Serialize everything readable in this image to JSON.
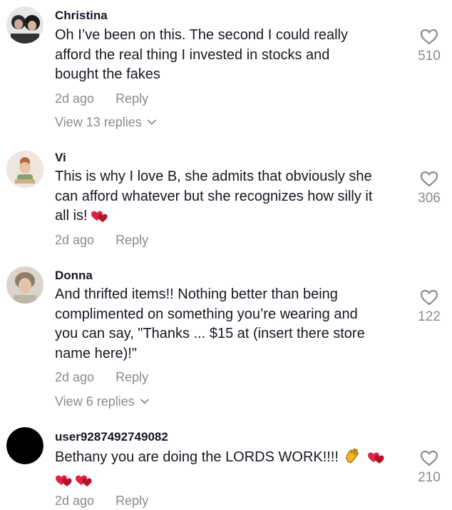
{
  "comments": [
    {
      "username": "Christina",
      "lines": [
        "Oh I’ve been on this. The second I could really",
        "afford the real thing I invested in stocks and",
        "bought the fakes"
      ],
      "time": "2d ago",
      "reply_label": "Reply",
      "view_replies": "View 13 replies",
      "likes": "510"
    },
    {
      "username": "Vi",
      "lines": [
        "This is why I love B, she admits that obviously she",
        "can afford whatever but she recognizes how silly it",
        "all is!"
      ],
      "time": "2d ago",
      "reply_label": "Reply",
      "likes": "306",
      "emoji": [
        "two-hearts-icon"
      ]
    },
    {
      "username": "Donna",
      "lines": [
        "And thrifted items!! Nothing better than being",
        "complimented on something you’re wearing and",
        "you can say, \"Thanks ... $15 at (insert there store",
        "name here)!\""
      ],
      "time": "2d ago",
      "reply_label": "Reply",
      "view_replies": "View 6 replies",
      "likes": "122"
    },
    {
      "username": "user9287492749082",
      "lines": [
        "Bethany you are doing the LORDS WORK!!!!"
      ],
      "time": "2d ago",
      "reply_label": "Reply",
      "likes": "210",
      "emoji": [
        "clapping-hands-icon",
        "two-hearts-icon",
        "two-hearts-icon",
        "two-hearts-icon"
      ]
    }
  ],
  "colors": {
    "text": "#161823",
    "muted": "#8a8b91",
    "heart": "#d7193a"
  }
}
